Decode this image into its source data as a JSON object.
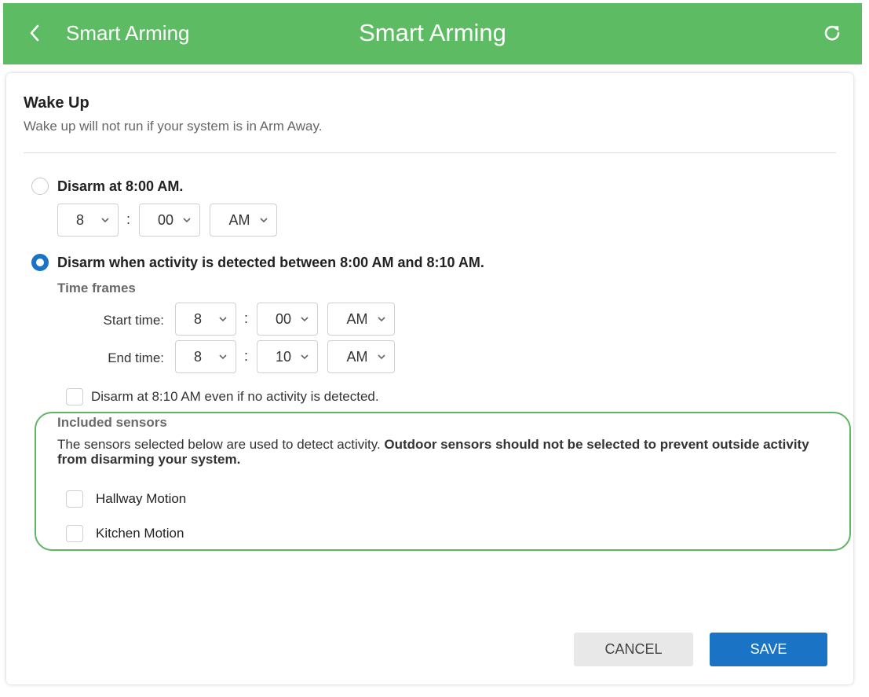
{
  "header": {
    "back_label": "Smart Arming",
    "title": "Smart Arming",
    "bg_color": "#5dbb63"
  },
  "section": {
    "title": "Wake Up",
    "description": "Wake up will not run if your system is in Arm Away."
  },
  "option_fixed": {
    "label": "Disarm at 8:00 AM.",
    "selected": false,
    "hour": "8",
    "minute": "00",
    "period": "AM"
  },
  "option_activity": {
    "label": "Disarm when activity is detected between 8:00 AM and 8:10 AM.",
    "selected": true,
    "time_frames_heading": "Time frames",
    "start": {
      "label": "Start time:",
      "hour": "8",
      "minute": "00",
      "period": "AM"
    },
    "end": {
      "label": "End time:",
      "hour": "8",
      "minute": "10",
      "period": "AM"
    },
    "fallback_label": "Disarm at 8:10 AM even if no activity is detected.",
    "fallback_checked": false
  },
  "colon": ":",
  "sensors": {
    "heading": "Included sensors",
    "description": "The sensors selected below are used to detect activity. ",
    "warning": "Outdoor sensors should not be selected to prevent outside activity from disarming your system.",
    "items": [
      {
        "label": "Hallway Motion",
        "checked": false
      },
      {
        "label": "Kitchen Motion",
        "checked": false
      }
    ]
  },
  "actions": {
    "cancel_label": "CANCEL",
    "save_label": "SAVE"
  },
  "colors": {
    "accent": "#1a73c4",
    "highlight": "#5fb565"
  }
}
